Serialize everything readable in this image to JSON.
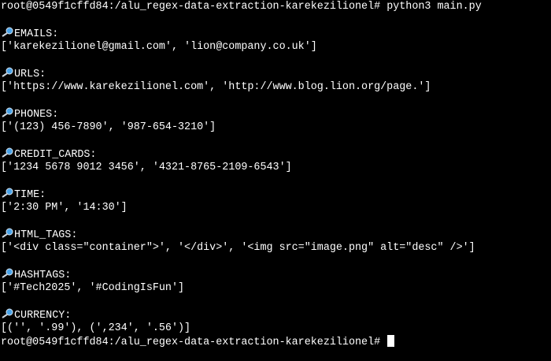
{
  "colors": {
    "background": "#000000",
    "text": "#ffffff",
    "magnifier_glass": "#4aa3e8",
    "magnifier_handle": "#c9d3dd"
  },
  "prompt_line": {
    "prompt": "root@0549f1cffd84:/alu_regex-data-extraction-karekezilionel#",
    "command": " python3 main.py"
  },
  "sections": [
    {
      "icon": "magnifier-icon",
      "label": "EMAILS:",
      "value": "['karekezilionel@gmail.com', 'lion@company.co.uk']"
    },
    {
      "icon": "magnifier-icon",
      "label": "URLS:",
      "value": "['https://www.karekezilionel.com', 'http://www.blog.lion.org/page.']"
    },
    {
      "icon": "magnifier-icon",
      "label": "PHONES:",
      "value": "['(123) 456-7890', '987-654-3210']"
    },
    {
      "icon": "magnifier-icon",
      "label": "CREDIT_CARDS:",
      "value": "['1234 5678 9012 3456', '4321-8765-2109-6543']"
    },
    {
      "icon": "magnifier-icon",
      "label": "TIME:",
      "value": "['2:30 PM', '14:30']"
    },
    {
      "icon": "magnifier-icon",
      "label": "HTML_TAGS:",
      "value": "['<div class=\"container\">', '</div>', '<img src=\"image.png\" alt=\"desc\" />']"
    },
    {
      "icon": "magnifier-icon",
      "label": "HASHTAGS:",
      "value": "['#Tech2025', '#CodingIsFun']"
    },
    {
      "icon": "magnifier-icon",
      "label": "CURRENCY:",
      "value": "[('', '.99'), (',234', '.56')]"
    }
  ],
  "final_prompt": {
    "prompt": "root@0549f1cffd84:/alu_regex-data-extraction-karekezilionel#",
    "cursor": "block-cursor"
  }
}
